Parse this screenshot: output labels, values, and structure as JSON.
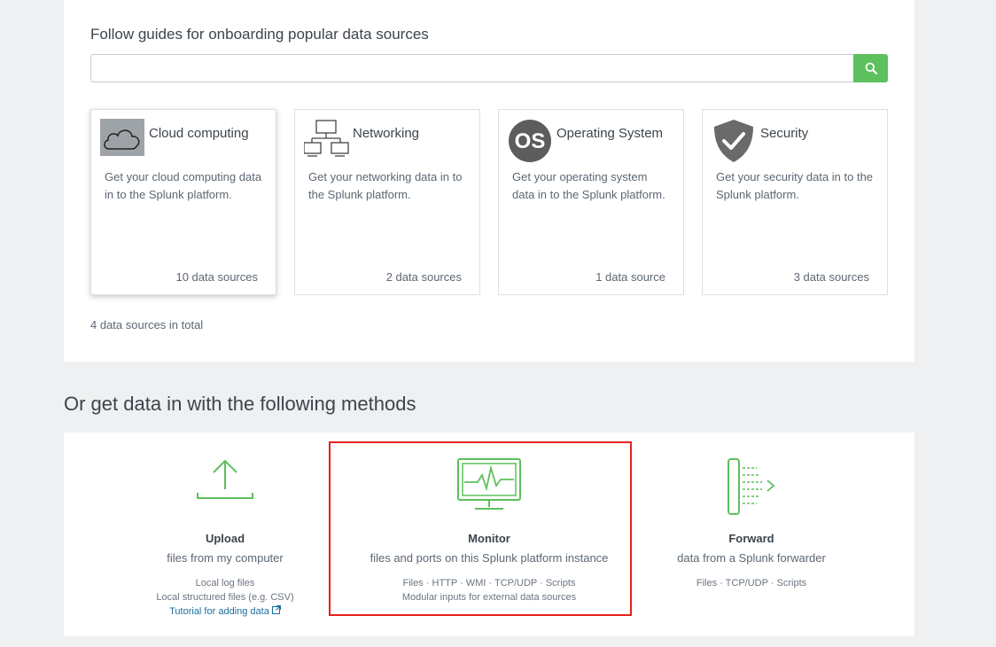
{
  "guides": {
    "title": "Follow guides for onboarding popular data sources",
    "search": {
      "value": "",
      "placeholder": ""
    },
    "cards": [
      {
        "title": "Cloud computing",
        "description": "Get your cloud computing data in to the Splunk platform.",
        "count": "10 data sources",
        "icon": "cloud-icon"
      },
      {
        "title": "Networking",
        "description": "Get your networking data in to the Splunk platform.",
        "count": "2 data sources",
        "icon": "network-icon"
      },
      {
        "title": "Operating System",
        "description": "Get your operating system data in to the Splunk platform.",
        "count": "1 data source",
        "icon": "os-icon"
      },
      {
        "title": "Security",
        "description": "Get your security data in to the Splunk platform.",
        "count": "3 data sources",
        "icon": "shield-icon"
      }
    ],
    "total": "4 data sources in total"
  },
  "methods": {
    "title": "Or get data in with the following methods",
    "items": [
      {
        "title": "Upload",
        "subtitle": "files from my computer",
        "details": [
          "Local log files",
          "Local structured files (e.g. CSV)"
        ],
        "link": "Tutorial for adding data",
        "icon": "upload-icon"
      },
      {
        "title": "Monitor",
        "subtitle": "files and ports on this Splunk platform instance",
        "details": [
          "Files · HTTP · WMI · TCP/UDP · Scripts",
          "Modular inputs for external data sources"
        ],
        "icon": "monitor-icon"
      },
      {
        "title": "Forward",
        "subtitle": "data from a Splunk forwarder",
        "details": [
          "Files · TCP/UDP · Scripts"
        ],
        "icon": "forward-icon"
      }
    ]
  },
  "colors": {
    "accent_green": "#5cc05c",
    "highlight_red": "#e52020",
    "link_blue": "#1a6f9e"
  }
}
